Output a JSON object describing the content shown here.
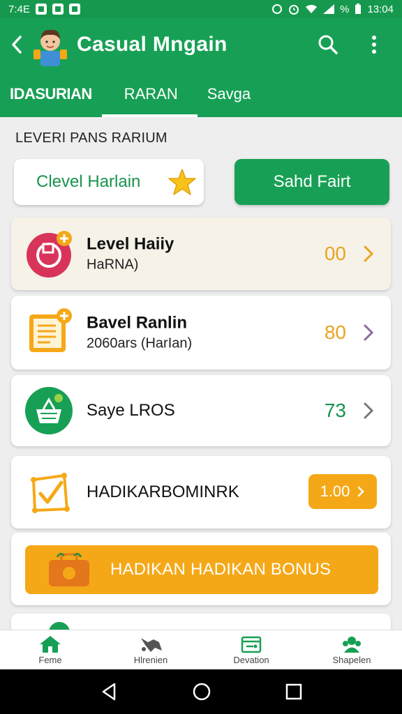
{
  "status_bar": {
    "time_left": "7:4E",
    "time_right": "13:04",
    "percent": "%"
  },
  "app_bar": {
    "title": "Casual Mngain"
  },
  "tabs": [
    {
      "label": "IDASURIAN"
    },
    {
      "label": "RARAN"
    },
    {
      "label": "Savga"
    }
  ],
  "section_label": "LEVERI PANS RARIUM",
  "buttons": {
    "level_harian": "Clevel Harlain",
    "sahd_fairt": "Sahd Fairt"
  },
  "cards": [
    {
      "title": "Level Haiiy",
      "subtitle": "HaRNA)",
      "value": "00"
    },
    {
      "title": "Bavel Ranlin",
      "subtitle": "2060ars (HarIan)",
      "value": "80"
    },
    {
      "title": "Saye LROS",
      "value": "73"
    },
    {
      "title": "HADIKARBOMINRK",
      "value": "1.00"
    }
  ],
  "bonus_button": "HADIKAN HADIKAN BONUS",
  "bottom_nav": [
    {
      "label": "Feme"
    },
    {
      "label": "Hlrenien"
    },
    {
      "label": "Devation"
    },
    {
      "label": "Shapelen"
    }
  ],
  "colors": {
    "primary_green": "#17a055",
    "accent_orange": "#f5a817"
  }
}
